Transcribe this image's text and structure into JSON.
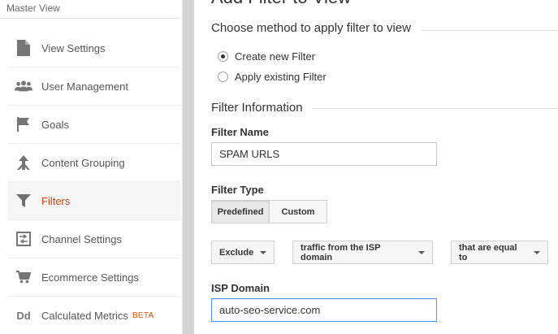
{
  "sidebar": {
    "header": "Master View",
    "items": [
      {
        "label": "View Settings",
        "icon": "document-icon"
      },
      {
        "label": "User Management",
        "icon": "users-icon"
      },
      {
        "label": "Goals",
        "icon": "flag-icon"
      },
      {
        "label": "Content Grouping",
        "icon": "grouping-icon"
      },
      {
        "label": "Filters",
        "icon": "filter-icon",
        "active": true
      },
      {
        "label": "Channel Settings",
        "icon": "channel-icon"
      },
      {
        "label": "Ecommerce Settings",
        "icon": "cart-icon"
      },
      {
        "label": "Calculated Metrics",
        "icon": "dd-icon",
        "icon_text": "Dd",
        "badge": "BETA"
      }
    ]
  },
  "main": {
    "page_title": "Add Filter to View",
    "method_section": {
      "title": "Choose method to apply filter to view",
      "options": [
        {
          "label": "Create new Filter",
          "checked": true
        },
        {
          "label": "Apply existing Filter",
          "checked": false
        }
      ]
    },
    "info_section": {
      "title": "Filter Information",
      "filter_name_label": "Filter Name",
      "filter_name_value": "SPAM URLS",
      "filter_type_label": "Filter Type",
      "filter_type_options": [
        "Predefined",
        "Custom"
      ],
      "filter_type_selected": "Predefined",
      "dropdowns": [
        "Exclude",
        "traffic from the ISP domain",
        "that are equal to"
      ],
      "isp_label": "ISP Domain",
      "isp_value": "auto-seo-service.com"
    }
  },
  "colors": {
    "active_nav": "#d84315",
    "beta": "#e65100",
    "focus_border": "#4d90fe",
    "gutter": "#d3d3d3"
  }
}
